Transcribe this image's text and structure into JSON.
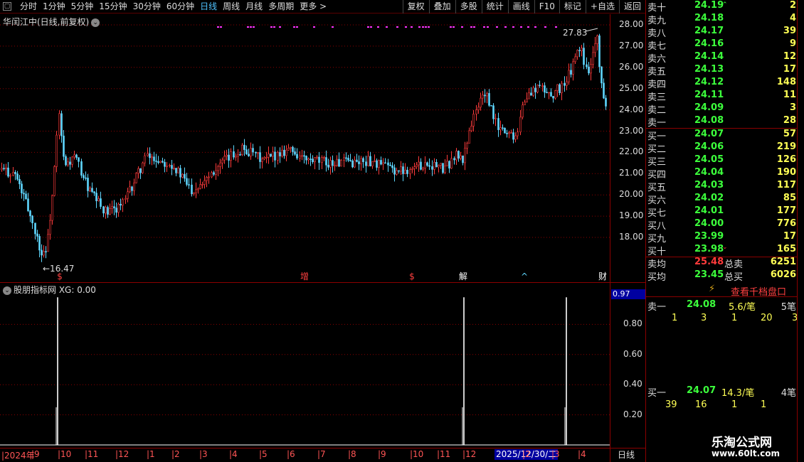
{
  "toolbar": {
    "close": "▢",
    "periods": [
      "分时",
      "1分钟",
      "5分钟",
      "15分钟",
      "30分钟",
      "60分钟",
      "日线",
      "周线",
      "月线",
      "多周期",
      "更多 >"
    ],
    "selected_period": "日线",
    "tools": [
      "复权",
      "叠加",
      "多股",
      "统计",
      "画线",
      "F10",
      "标记",
      "+自选",
      "返回"
    ]
  },
  "chart": {
    "title": "华闰江中(日线,前复权)",
    "y_ticks": [
      "28.00",
      "27.00",
      "26.00",
      "25.00",
      "24.00",
      "23.00",
      "22.00",
      "21.00",
      "20.00",
      "19.00",
      "18.00"
    ],
    "high_label": "27.83",
    "low_label": "16.47",
    "markers": [
      "$",
      "增",
      "$",
      "解",
      "^",
      "财"
    ]
  },
  "indicator": {
    "title": "股朋指标网  XG: 0.00",
    "current_value": "0.97",
    "y_ticks": [
      "0.80",
      "0.60",
      "0.40",
      "0.20"
    ]
  },
  "date_axis": {
    "ticks": [
      "2024年",
      "9",
      "10",
      "11",
      "12",
      "1",
      "2",
      "3",
      "4",
      "5",
      "6",
      "7",
      "8",
      "9",
      "10",
      "11",
      "12",
      "2",
      "3",
      "4"
    ],
    "cursor": "2025/12/30/二",
    "period": "日线"
  },
  "orderbook": {
    "asks": [
      {
        "label": "卖十",
        "price": "24.19",
        "vol": "2"
      },
      {
        "label": "卖九",
        "price": "24.18",
        "vol": "4"
      },
      {
        "label": "卖八",
        "price": "24.17",
        "vol": "39"
      },
      {
        "label": "卖七",
        "price": "24.16",
        "vol": "9"
      },
      {
        "label": "卖六",
        "price": "24.14",
        "vol": "12"
      },
      {
        "label": "卖五",
        "price": "24.13",
        "vol": "17"
      },
      {
        "label": "卖四",
        "price": "24.12",
        "vol": "148"
      },
      {
        "label": "卖三",
        "price": "24.11",
        "vol": "11"
      },
      {
        "label": "卖二",
        "price": "24.09",
        "vol": "3"
      },
      {
        "label": "卖一",
        "price": "24.08",
        "vol": "28"
      }
    ],
    "bids": [
      {
        "label": "买一",
        "price": "24.07",
        "vol": "57"
      },
      {
        "label": "买二",
        "price": "24.06",
        "vol": "219"
      },
      {
        "label": "买三",
        "price": "24.05",
        "vol": "126"
      },
      {
        "label": "买四",
        "price": "24.04",
        "vol": "190"
      },
      {
        "label": "买五",
        "price": "24.03",
        "vol": "117"
      },
      {
        "label": "买六",
        "price": "24.02",
        "vol": "85"
      },
      {
        "label": "买七",
        "price": "24.01",
        "vol": "177"
      },
      {
        "label": "买八",
        "price": "24.00",
        "vol": "776"
      },
      {
        "label": "买九",
        "price": "23.99",
        "vol": "17"
      },
      {
        "label": "买十",
        "price": "23.98",
        "vol": "165"
      }
    ],
    "avg_sell_label": "卖均",
    "avg_sell": "25.48",
    "total_sell_label": "总卖",
    "total_sell": "6251",
    "avg_buy_label": "买均",
    "avg_buy": "23.45",
    "total_buy_label": "总买",
    "total_buy": "6026"
  },
  "depth": {
    "link": "查看千档盘口",
    "ask_label": "卖一",
    "ask_price": "24.08",
    "ask_per": "5.6/笔",
    "ask_count": "5笔",
    "ask_orders": [
      "1",
      "3",
      "1",
      "20",
      "3"
    ],
    "bid_label": "买一",
    "bid_price": "24.07",
    "bid_per": "14.3/笔",
    "bid_count": "4笔",
    "bid_orders": [
      "39",
      "16",
      "1",
      "1"
    ]
  },
  "watermark": {
    "name": "乐淘公式网",
    "url": "www.60lt.com"
  },
  "colors": {
    "up": "#ff3b3b",
    "down": "#5fd7ff",
    "grid": "#8b0000",
    "signal": "#ff33ff",
    "indicator": "#ffffff"
  }
}
